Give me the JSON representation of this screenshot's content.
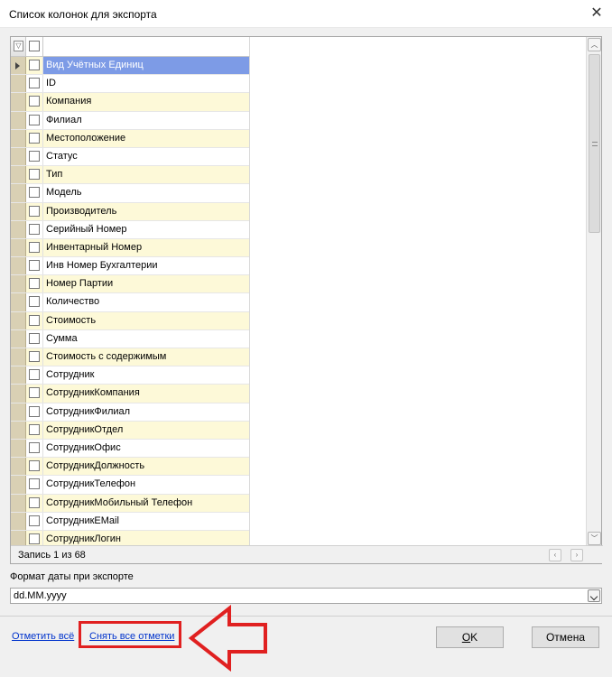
{
  "dialog": {
    "title": "Список колонок для экспорта"
  },
  "grid": {
    "rows": [
      {
        "label": "Вид Учётных Единиц",
        "selected": true
      },
      {
        "label": "ID"
      },
      {
        "label": "Компания"
      },
      {
        "label": "Филиал"
      },
      {
        "label": "Местоположение"
      },
      {
        "label": "Статус"
      },
      {
        "label": "Тип"
      },
      {
        "label": "Модель"
      },
      {
        "label": "Производитель"
      },
      {
        "label": "Серийный Номер"
      },
      {
        "label": "Инвентарный Номер"
      },
      {
        "label": "Инв Номер Бухгалтерии"
      },
      {
        "label": "Номер Партии"
      },
      {
        "label": "Количество"
      },
      {
        "label": "Стоимость"
      },
      {
        "label": "Сумма"
      },
      {
        "label": "Стоимость с содержимым"
      },
      {
        "label": "Сотрудник"
      },
      {
        "label": "СотрудникКомпания"
      },
      {
        "label": "СотрудникФилиал"
      },
      {
        "label": "СотрудникОтдел"
      },
      {
        "label": "СотрудникОфис"
      },
      {
        "label": "СотрудникДолжность"
      },
      {
        "label": "СотрудникТелефон"
      },
      {
        "label": "СотрудникМобильный Телефон"
      },
      {
        "label": "СотрудникEMail"
      },
      {
        "label": "СотрудникЛогин"
      }
    ],
    "record_info": "Запись 1 из 68"
  },
  "date_format": {
    "label": "Формат даты при экспорте",
    "value": "dd.MM.yyyy"
  },
  "footer": {
    "check_all": "Отметить всё",
    "uncheck_all": "Снять все отметки",
    "ok_underlined": "O",
    "ok_rest": "K",
    "cancel": "Отмена"
  },
  "colors": {
    "alt_row": "#fdf9d8",
    "selected_row": "#7d9be6",
    "annotation": "#e02020"
  }
}
